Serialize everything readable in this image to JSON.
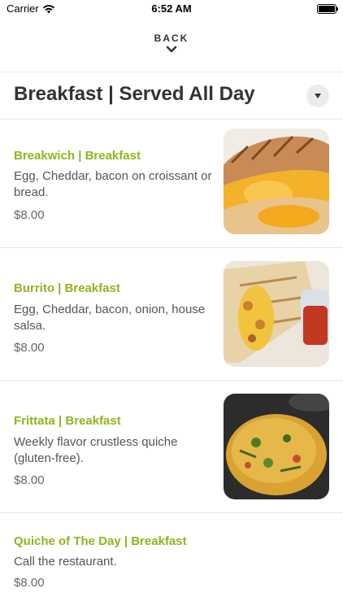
{
  "status_bar": {
    "carrier": "Carrier",
    "time": "6:52 AM"
  },
  "nav": {
    "back_label": "BACK"
  },
  "section": {
    "title": "Breakfast | Served All Day"
  },
  "items": [
    {
      "name": "Breakwich | Breakfast",
      "description": "Egg, Cheddar, bacon on croissant or bread.",
      "price": "$8.00"
    },
    {
      "name": "Burrito | Breakfast",
      "description": "Egg, Cheddar, bacon, onion, house salsa.",
      "price": "$8.00"
    },
    {
      "name": "Frittata | Breakfast",
      "description": "Weekly flavor crustless quiche (gluten-free).",
      "price": "$8.00"
    },
    {
      "name": "Quiche of The Day | Breakfast",
      "description": "Call the restaurant.",
      "price": "$8.00"
    }
  ],
  "colors": {
    "item_name": "#8fb51c",
    "divider": "#e6e6e6",
    "text": "#333333"
  }
}
